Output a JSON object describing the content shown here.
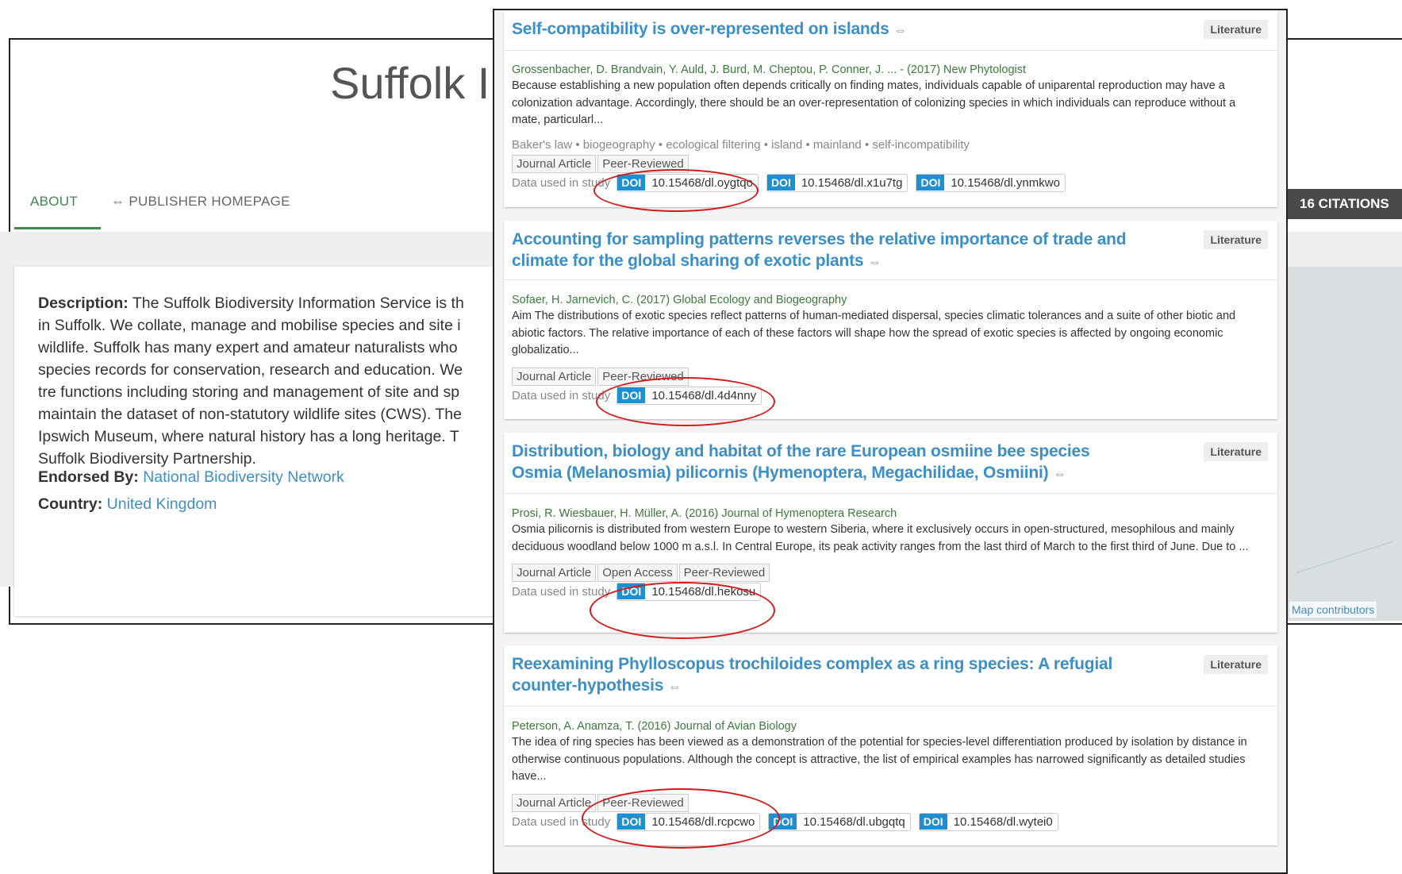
{
  "background_page": {
    "title": "Suffolk I",
    "tabs": {
      "about": "ABOUT",
      "publisher": "⇔ PUBLISHER HOMEPAGE"
    },
    "citations_badge": "16 CITATIONS",
    "description_label": "Description:",
    "description_lines": [
      " The Suffolk Biodiversity Information Service is th",
      "in Suffolk. We collate, manage and mobilise species and site i",
      "wildlife. Suffolk has many expert and amateur naturalists who",
      "species records for conservation, research and education. We",
      "tre functions including storing and management of site and sp",
      "maintain the dataset of non-statutory wildlife sites (CWS). The",
      "Ipswich Museum, where natural history has a long heritage. T",
      "Suffolk Biodiversity Partnership."
    ],
    "endorsed_label": "Endorsed By:",
    "endorsed_value": "National Biodiversity Network",
    "country_label": "Country:",
    "country_value": "United Kingdom",
    "map_attribution": "Map contributors"
  },
  "literature": [
    {
      "title": "Self-compatibility is over-represented on islands",
      "badge": "Literature",
      "authors": "Grossenbacher, D. Brandvain, Y. Auld, J. Burd, M. Cheptou, P. Conner, J. ... - (2017) New Phytologist",
      "abstract": "Because establishing a new population often depends critically on finding mates, individuals capable of uniparental reproduction may have a colonization advantage. Accordingly, there should be an over-representation of colonizing species in which individuals can reproduce without a mate, particularl...",
      "keywords": "Baker's law • biogeography • ecological filtering • island • mainland • self-incompatibility",
      "tags": [
        "Journal Article",
        "Peer-Reviewed"
      ],
      "data_label": "Data used in study",
      "doi_label": "DOI",
      "dois": [
        "10.15468/dl.oygtqo",
        "10.15468/dl.x1u7tg",
        "10.15468/dl.ynmkwo"
      ]
    },
    {
      "title": "Accounting for sampling patterns reverses the relative importance of trade and climate for the global sharing of exotic plants",
      "badge": "Literature",
      "authors": "Sofaer, H. Jarnevich, C. (2017) Global Ecology and Biogeography",
      "abstract": "Aim The distributions of exotic species reflect patterns of human-mediated dispersal, species climatic tolerances and a suite of other biotic and abiotic factors. The relative importance of each of these factors will shape how the spread of exotic species is affected by ongoing economic globalizatio...",
      "tags": [
        "Journal Article",
        "Peer-Reviewed"
      ],
      "data_label": "Data used in study",
      "doi_label": "DOI",
      "dois": [
        "10.15468/dl.4d4nny"
      ]
    },
    {
      "title": "Distribution, biology and habitat of the rare European osmiine bee species Osmia (Melanosmia) pilicornis (Hymenoptera, Megachilidae, Osmiini)",
      "badge": "Literature",
      "authors": "Prosi, R. Wiesbauer, H. Müller, A. (2016) Journal of Hymenoptera Research",
      "abstract": "Osmia pilicornis is distributed from western Europe to western Siberia, where it exclusively occurs in open-structured, mesophilous and mainly deciduous woodland below 1000 m a.s.l. In Central Europe, its peak activity ranges from the last third of March to the first third of June. Due to ...",
      "tags": [
        "Journal Article",
        "Open Access",
        "Peer-Reviewed"
      ],
      "data_label": "Data used in study",
      "doi_label": "DOI",
      "dois": [
        "10.15468/dl.hekosu"
      ]
    },
    {
      "title": "Reexamining Phylloscopus trochiloides complex as a ring species: A refugial counter-hypothesis",
      "badge": "Literature",
      "authors": "Peterson, A. Anamza, T. (2016) Journal of Avian Biology",
      "abstract": "The idea of ring species has been viewed as a demonstration of the potential for species-level differentiation produced by isolation by distance in otherwise continuous populations. Although the concept is attractive, the list of empirical examples has narrowed significantly as detailed studies have...",
      "tags": [
        "Journal Article",
        "Peer-Reviewed"
      ],
      "data_label": "Data used in study",
      "doi_label": "DOI",
      "dois": [
        "10.15468/dl.rcpcwo",
        "10.15468/dl.ubgqtq",
        "10.15468/dl.wytei0"
      ]
    }
  ],
  "link_icon": "⇔"
}
